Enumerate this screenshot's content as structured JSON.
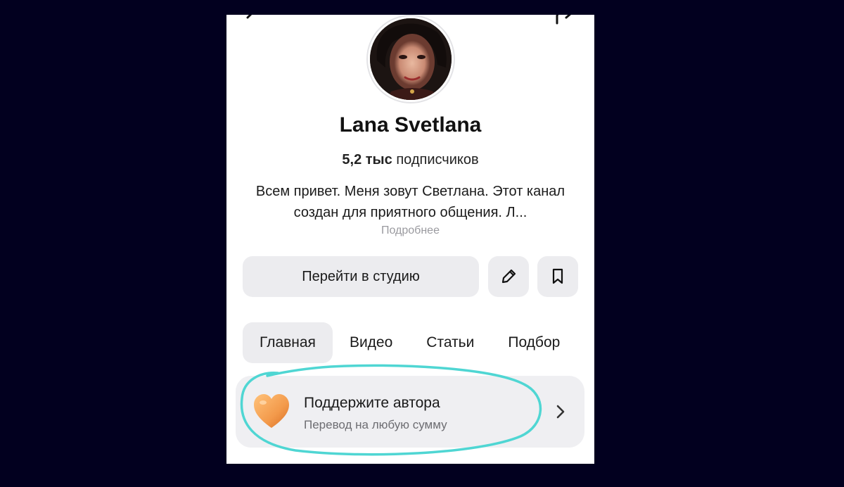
{
  "profile": {
    "name": "Lana Svetlana",
    "subscribers_count": "5,2 тыс",
    "subscribers_label": "подписчиков",
    "description": "Всем привет.  Меня зовут Светлана. Этот канал создан для приятного общения. Л...",
    "more_label": "Подробнее"
  },
  "actions": {
    "studio_label": "Перейти в студию"
  },
  "tabs": [
    {
      "label": "Главная",
      "active": true
    },
    {
      "label": "Видео",
      "active": false
    },
    {
      "label": "Статьи",
      "active": false
    },
    {
      "label": "Подбор",
      "active": false
    }
  ],
  "support": {
    "title": "Поддержите автора",
    "subtitle": "Перевод на любую сумму"
  },
  "colors": {
    "page_background": "#02001f",
    "button_background": "#ececef",
    "highlight_annotation": "#4fd6d3",
    "heart": "#f39a4b"
  },
  "icons": {
    "back": "back-arrow-icon",
    "share": "share-icon",
    "edit": "pencil-icon",
    "bookmark": "bookmark-icon",
    "heart": "heart-icon",
    "chevron": "chevron-right-icon"
  }
}
